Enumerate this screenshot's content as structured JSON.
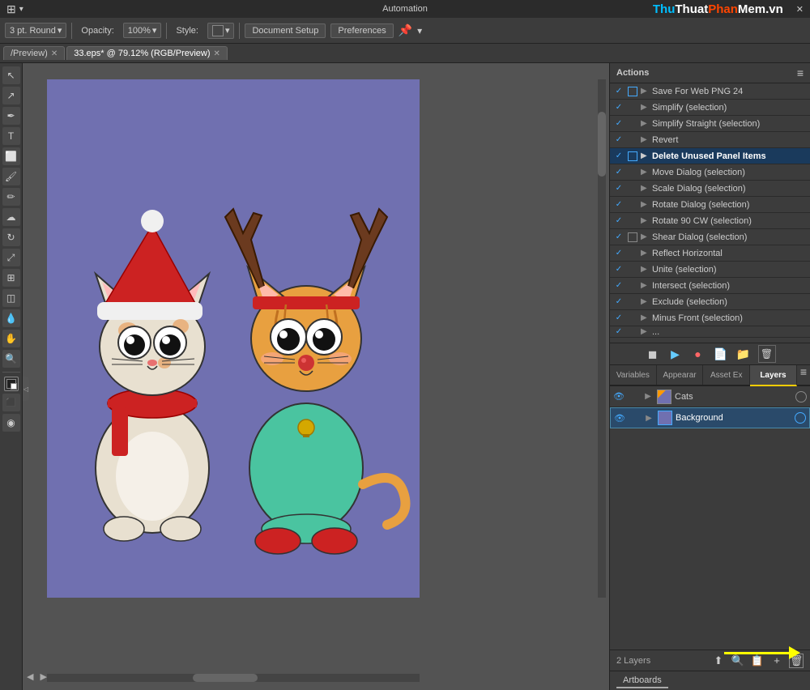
{
  "topbar": {
    "automation_label": "Automation",
    "watermark": "ThuThuatPhanMem.vn",
    "close_btn": "✕"
  },
  "toolbar": {
    "brush_size_label": "3 pt. Round",
    "opacity_label": "Opacity:",
    "opacity_value": "100%",
    "style_label": "Style:",
    "document_setup": "Document Setup",
    "preferences": "Preferences"
  },
  "tabs": [
    {
      "label": "/Preview)",
      "active": false
    },
    {
      "label": "33.eps* @ 79.12% (RGB/Preview)",
      "active": true
    }
  ],
  "actions_panel": {
    "title": "Actions",
    "items": [
      {
        "checked": true,
        "has_box": true,
        "highlighted": false,
        "label": "Save For Web PNG 24"
      },
      {
        "checked": true,
        "has_box": false,
        "highlighted": false,
        "label": "Simplify (selection)"
      },
      {
        "checked": true,
        "has_box": false,
        "highlighted": false,
        "label": "Simplify Straight (selection)"
      },
      {
        "checked": true,
        "has_box": false,
        "highlighted": false,
        "label": "Revert"
      },
      {
        "checked": true,
        "has_box": true,
        "highlighted": true,
        "label": "Delete Unused Panel Items"
      },
      {
        "checked": true,
        "has_box": false,
        "highlighted": false,
        "label": "Move Dialog (selection)"
      },
      {
        "checked": true,
        "has_box": false,
        "highlighted": false,
        "label": "Scale Dialog (selection)"
      },
      {
        "checked": true,
        "has_box": false,
        "highlighted": false,
        "label": "Rotate Dialog (selection)"
      },
      {
        "checked": true,
        "has_box": false,
        "highlighted": false,
        "label": "Rotate 90 CW (selection)"
      },
      {
        "checked": true,
        "has_box": true,
        "highlighted": false,
        "label": "Shear Dialog (selection)"
      },
      {
        "checked": true,
        "has_box": false,
        "highlighted": false,
        "label": "Reflect Horizontal"
      },
      {
        "checked": true,
        "has_box": false,
        "highlighted": false,
        "label": "Unite (selection)"
      },
      {
        "checked": true,
        "has_box": false,
        "highlighted": false,
        "label": "Intersect (selection)"
      },
      {
        "checked": true,
        "has_box": false,
        "highlighted": false,
        "label": "Exclude (selection)"
      },
      {
        "checked": true,
        "has_box": false,
        "highlighted": false,
        "label": "Minus Front (selection)"
      }
    ]
  },
  "panel_tabs": [
    {
      "label": "Variables",
      "active": false
    },
    {
      "label": "Appearar",
      "active": false
    },
    {
      "label": "Asset Ex",
      "active": false
    },
    {
      "label": "Layers",
      "active": true
    }
  ],
  "layers": {
    "count_label": "2 Layers",
    "items": [
      {
        "name": "Cats",
        "selected": false,
        "eye": true,
        "lock": false,
        "thumb_type": "cats"
      },
      {
        "name": "Background",
        "selected": true,
        "eye": true,
        "lock": false,
        "thumb_type": "bg"
      }
    ],
    "bottom_icons": [
      "⬆",
      "🔍",
      "📋",
      "➕",
      "🗑"
    ]
  },
  "artboards_tab": {
    "label": "Artboards"
  },
  "tools": [
    "✦",
    "↖",
    "P",
    "T",
    "⬜",
    "⬤",
    "✏",
    "☁",
    "⚙",
    "✂",
    "⬛",
    "◉"
  ]
}
